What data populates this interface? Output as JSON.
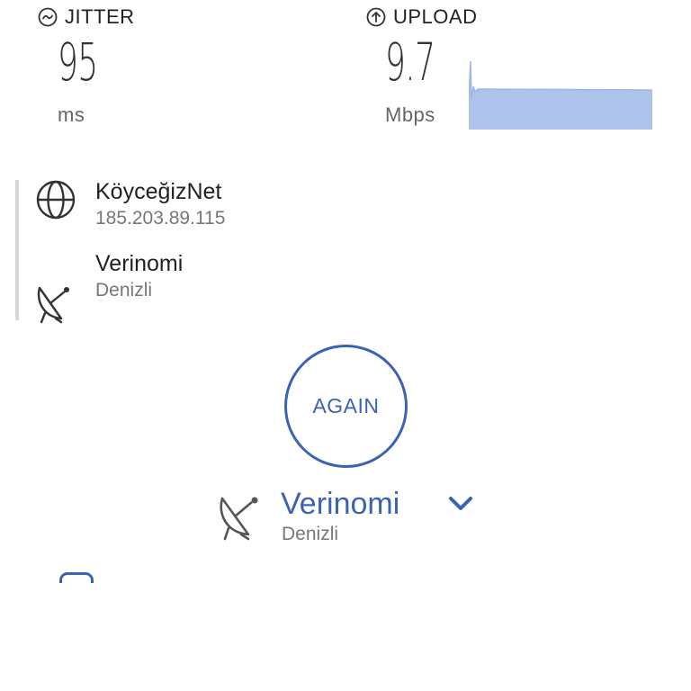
{
  "jitter": {
    "label": "JITTER",
    "value": "95",
    "unit": "ms"
  },
  "upload": {
    "label": "UPLOAD",
    "value": "9.7",
    "unit": "Mbps"
  },
  "isp": {
    "name": "KöyceğizNet",
    "ip": "185.203.89.115"
  },
  "server": {
    "name": "Verinomi",
    "location": "Denizli"
  },
  "again_label": "AGAIN",
  "selected_server": {
    "name": "Verinomi",
    "location": "Denizli"
  },
  "colors": {
    "accent": "#3b63b3",
    "graph_fill": "#adc3ea",
    "graph_line": "#9fb6e4"
  }
}
